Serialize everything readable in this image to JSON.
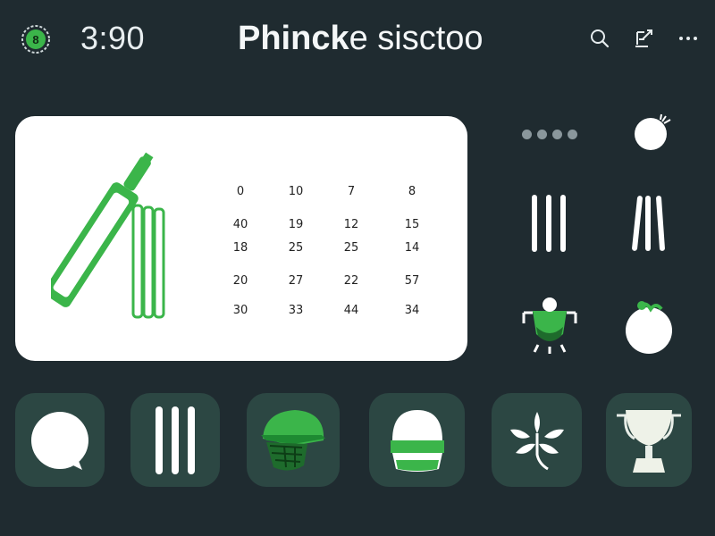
{
  "header": {
    "logo_icon": "cricket-ball-badge-icon",
    "logo_letter": "8",
    "time": "3:90",
    "title_bold": "Phinck",
    "title_rest": "e sisctoo",
    "icons": [
      "search-icon",
      "edit-share-icon",
      "more-options-icon"
    ]
  },
  "scorecard": {
    "rows": [
      [
        "0",
        "10",
        "7",
        "8"
      ],
      [
        "40",
        "19",
        "12",
        "15"
      ],
      [
        "18",
        "25",
        "25",
        "14"
      ],
      [
        "20",
        "27",
        "22",
        "57"
      ],
      [
        "30",
        "33",
        "44",
        "34"
      ]
    ]
  },
  "side_icons": [
    "pagination-dots",
    "cricket-ball-icon",
    "stumps-icon",
    "stumps-angled-icon",
    "trophy-helmet-icon",
    "ball-leaf-icon"
  ],
  "tiles": [
    "chat-bubble-icon",
    "stumps-icon",
    "batting-helmet-icon",
    "cap-icon",
    "leaf-emblem-icon",
    "trophy-icon"
  ],
  "colors": {
    "background": "#1f2b30",
    "accent_green": "#3bb54a",
    "tile_background": "#2c4743",
    "card_background": "#ffffff"
  }
}
